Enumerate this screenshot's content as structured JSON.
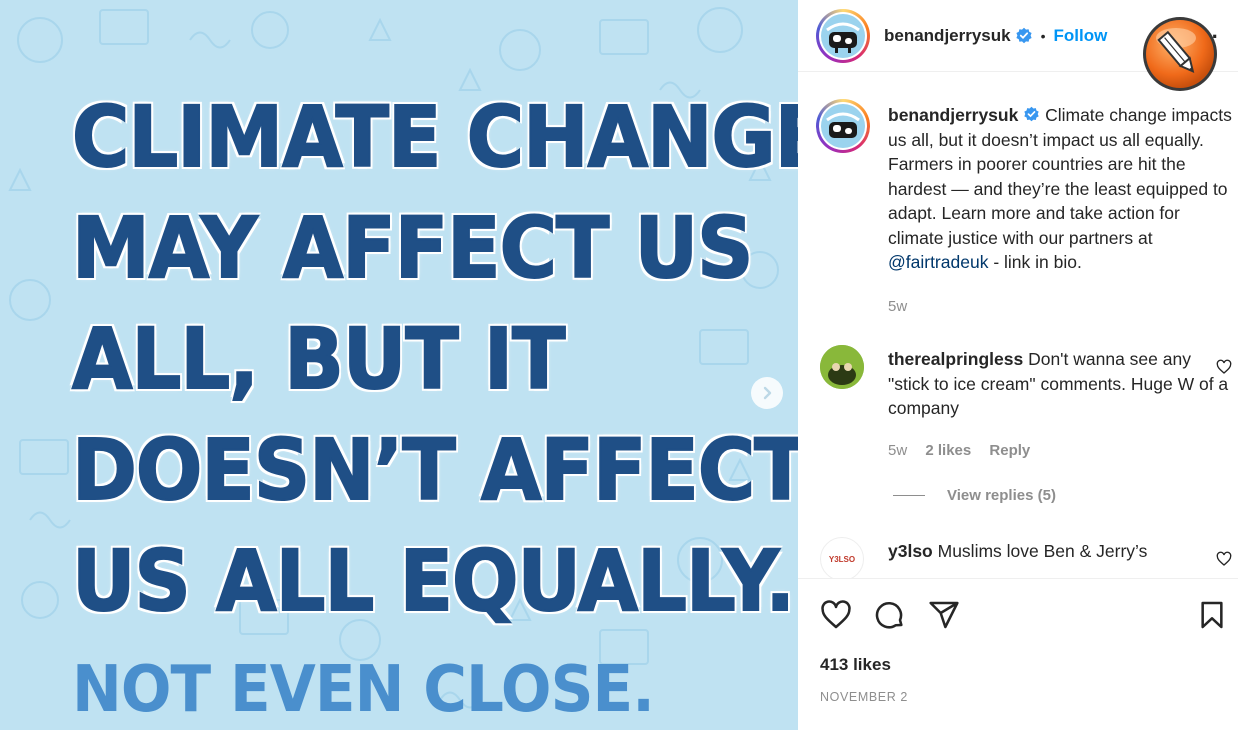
{
  "post_image": {
    "headline_lines": [
      "CLIMATE CHANGE",
      "MAY AFFECT US",
      "ALL, BUT IT",
      "DOESN’T AFFECT",
      "US ALL EQUALLY."
    ],
    "subline": "NOT EVEN CLOSE.",
    "next_icon": "chevron-right-icon"
  },
  "header": {
    "username": "benandjerrysuk",
    "verified_icon": "verified-badge-icon",
    "separator": "•",
    "follow_label": "Follow",
    "more_label": "···"
  },
  "caption": {
    "username": "benandjerrysuk",
    "text": "Climate change impacts us all, but it doesn’t impact us all equally. Farmers in poorer countries are hit the hardest — and they’re the least equipped to adapt. Learn more and take action for climate justice with our partners at ",
    "mention": "@fairtradeuk",
    "text_after": " - link in bio.",
    "time": "5w"
  },
  "comments": [
    {
      "username": "therealpringless",
      "text": "Don't wanna see any \"stick to ice cream\" comments. Huge W of a company",
      "time": "5w",
      "likes": "2 likes",
      "reply_label": "Reply",
      "view_replies": "View replies (5)"
    },
    {
      "username": "y3lso",
      "text": "Muslims love Ben & Jerry’s",
      "avatar_text": "Y3LSO"
    }
  ],
  "actions": {
    "likes": "413 likes",
    "date": "NOVEMBER 2"
  },
  "colors": {
    "accent_blue": "#0095f6",
    "headline_blue": "#1f4f86",
    "subline_blue": "#4a8fcd",
    "image_bg": "#bfe2f2"
  }
}
